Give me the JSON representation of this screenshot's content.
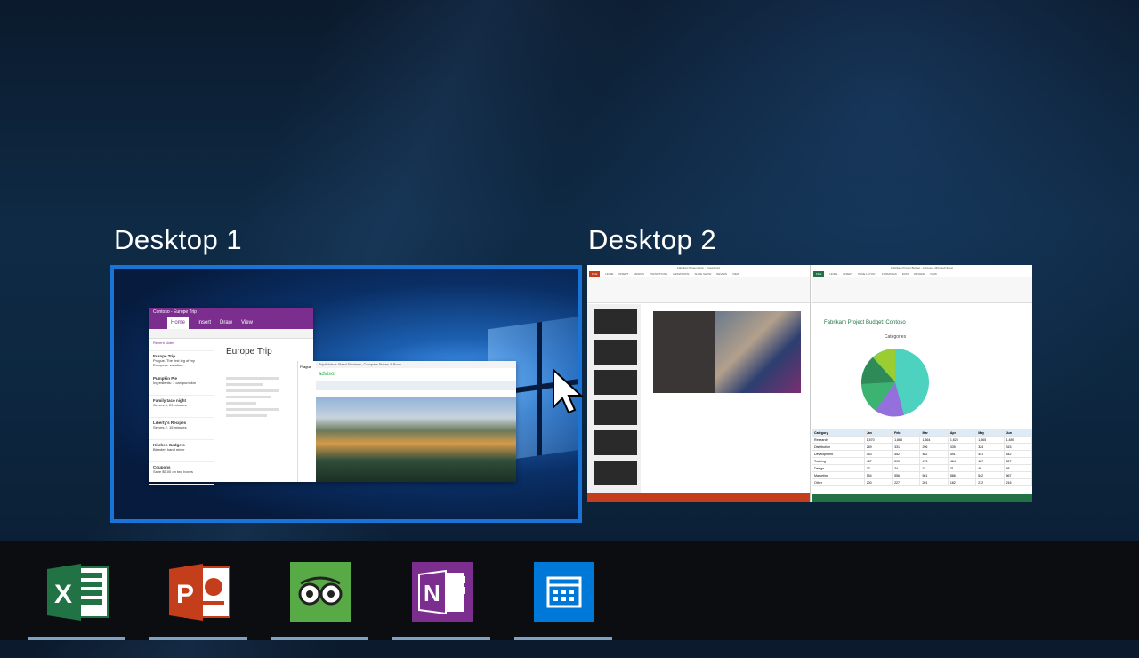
{
  "desktops": [
    {
      "label": "Desktop 1"
    },
    {
      "label": "Desktop 2"
    }
  ],
  "desktop1": {
    "onenote": {
      "title": "Contoso - Europe Trip",
      "tabs": [
        "Home",
        "Insert",
        "Draw",
        "View"
      ],
      "notes_header": "Recent Notes",
      "notes": [
        {
          "title": "Europe Trip",
          "text": "Prague. The first leg of my European vacation."
        },
        {
          "title": "Pumpkin Pie",
          "text": "Ingredients: 1 can pumpkin"
        },
        {
          "title": "Family taco night",
          "text": "Serves 4, 20 minutes"
        },
        {
          "title": "Liberty's Recipes",
          "text": "Serves 2, 15 minutes"
        },
        {
          "title": "Kitchen Gadgets",
          "text": "Blender, hand mixer"
        },
        {
          "title": "Coupons",
          "text": "Save $5.00 on two boxes"
        }
      ],
      "page_title": "Europe Trip"
    },
    "browser": {
      "title": "TripAdvisor: Read Reviews, Compare Prices & Book",
      "brand": "advisor",
      "prague": "Prague"
    }
  },
  "desktop2": {
    "powerpoint": {
      "title": "Fabrikam Presentation - PowerPoint",
      "tabs": [
        "FILE",
        "HOME",
        "INSERT",
        "DESIGN",
        "TRANSITIONS",
        "ANIMATIONS",
        "SLIDE SHOW",
        "REVIEW",
        "VIEW"
      ]
    },
    "excel": {
      "title": "Fabrikam Project Budget - Contoso - Microsoft Excel",
      "tabs": [
        "FILE",
        "HOME",
        "INSERT",
        "PAGE LAYOUT",
        "FORMULAS",
        "DATA",
        "REVIEW",
        "VIEW"
      ],
      "heading": "Fabrikam Project Budget: Contoso",
      "chart_title": "Categories",
      "table": {
        "headers": [
          "Category",
          "Jan",
          "Feb",
          "Mar",
          "Apr",
          "May",
          "Jun"
        ],
        "rows": [
          [
            "Research",
            "1,570",
            "1,865",
            "1,364",
            "1,626",
            "1,565",
            "1,489"
          ],
          [
            "Distribution",
            "269",
            "331",
            "296",
            "335",
            "324",
            "315"
          ],
          [
            "Development",
            "463",
            "452",
            "482",
            "491",
            "441",
            "442"
          ],
          [
            "Training",
            "467",
            "590",
            "473",
            "464",
            "487",
            "527"
          ],
          [
            "Design",
            "23",
            "34",
            "21",
            "31",
            "46",
            "58"
          ],
          [
            "Marketing",
            "554",
            "556",
            "561",
            "586",
            "542",
            "567"
          ],
          [
            "Other",
            "200",
            "227",
            "201",
            "182",
            "212",
            "216"
          ]
        ]
      },
      "sheet_tab": "Contoso"
    }
  },
  "taskbar": [
    {
      "name": "excel",
      "label": "X",
      "color": "#217346"
    },
    {
      "name": "powerpoint",
      "label": "P",
      "color": "#c43e1c"
    },
    {
      "name": "tripadvisor",
      "label": "",
      "color": "#58aa47"
    },
    {
      "name": "onenote",
      "label": "N",
      "color": "#7b2e8e"
    },
    {
      "name": "calendar",
      "label": "",
      "color": "#0078d7"
    }
  ]
}
